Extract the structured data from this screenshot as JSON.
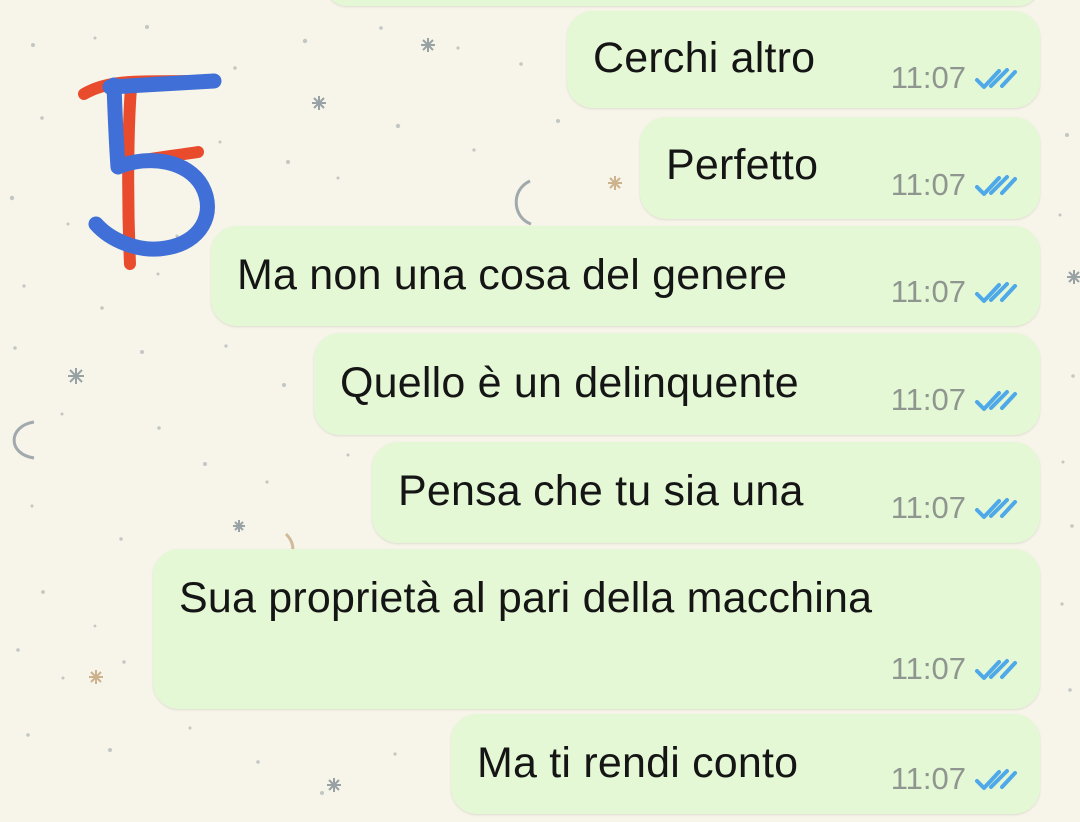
{
  "messages": [
    {
      "text": "Cerchi altro",
      "time": "11:07",
      "status": "read"
    },
    {
      "text": "Perfetto",
      "time": "11:07",
      "status": "read"
    },
    {
      "text": "Ma non una cosa del genere",
      "time": "11:07",
      "status": "read"
    },
    {
      "text": "Quello è un delinquente",
      "time": "11:07",
      "status": "read"
    },
    {
      "text": "Pensa che tu sia una",
      "time": "11:07",
      "status": "read"
    },
    {
      "text": "Sua proprietà al pari della macchina",
      "time": "11:07",
      "status": "read"
    },
    {
      "text": "Ma ti rendi conto",
      "time": "11:07",
      "status": "read"
    }
  ],
  "overlay": {
    "label": "5"
  },
  "colors": {
    "bubble": "#e4f8d5",
    "background": "#f7f4e9",
    "read_ticks": "#4fa8e8",
    "time": "#8f958f",
    "overlay_red": "#e94b2d",
    "overlay_blue": "#3f6fd7"
  },
  "icons": {
    "status": "double-check-read-icon",
    "overlay": "number-five-marker"
  }
}
